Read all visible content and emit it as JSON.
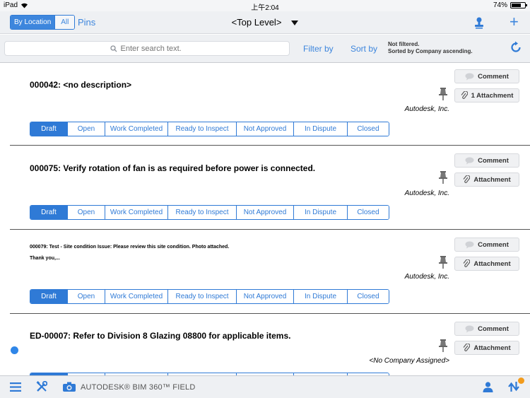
{
  "status_bar": {
    "device": "iPad",
    "time": "上午2:04",
    "battery": "74%",
    "battery_level": 0.74
  },
  "nav": {
    "view_options": [
      "By Location",
      "All"
    ],
    "pins": "Pins",
    "level": "<Top Level>"
  },
  "search": {
    "placeholder": "Enter search text.",
    "filter_by": "Filter by",
    "sort_by": "Sort by",
    "filter_status": "Not filtered.",
    "sort_status": "Sorted by Company ascending."
  },
  "statuses": [
    "Draft",
    "Open",
    "Work Completed",
    "Ready to Inspect",
    "Not Approved",
    "In Dispute",
    "Closed"
  ],
  "items": [
    {
      "title": "000042: <no description>",
      "company": "Autodesk, Inc.",
      "comment": "Comment",
      "attachment": "1 Attachment",
      "selected_status": "Draft"
    },
    {
      "title": "000075: Verify rotation of fan is as required before power is connected.",
      "company": "Autodesk, Inc.",
      "comment": "Comment",
      "attachment": "Attachment",
      "selected_status": "Draft"
    },
    {
      "title": "000079: Test - Site condition Issue: Please review this site condition.  Photo attached.",
      "title_line2": "Thank you,...",
      "company": "Autodesk, Inc.",
      "comment": "Comment",
      "attachment": "Attachment",
      "selected_status": "Draft"
    },
    {
      "title": "ED-00007: Refer to Division 8 Glazing 08800 for applicable items.",
      "company": "<No Company Assigned>",
      "comment": "Comment",
      "attachment": "Attachment",
      "selected_status": "Draft",
      "unread": true
    }
  ],
  "toolbar": {
    "brand": "AUTODESK® BIM 360™ FIELD"
  },
  "colors": {
    "accent": "#2f7ad6",
    "notification": "#f29b1c"
  }
}
